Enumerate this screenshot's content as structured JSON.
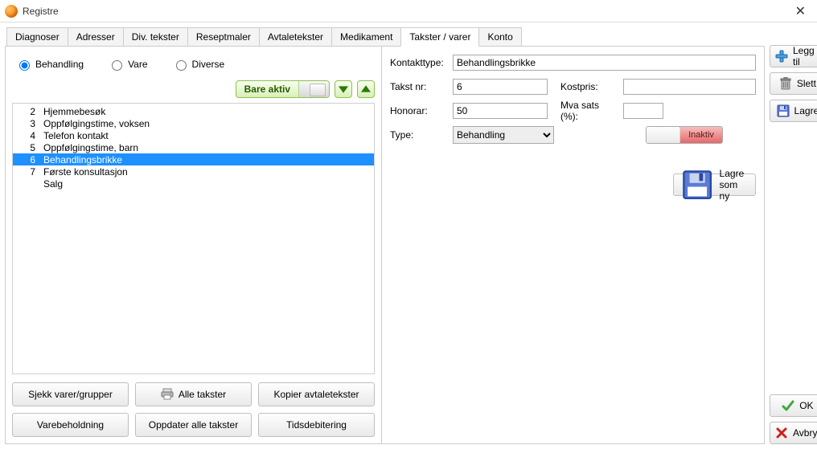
{
  "window": {
    "title": "Registre"
  },
  "tabs": [
    "Diagnoser",
    "Adresser",
    "Div. tekster",
    "Reseptmaler",
    "Avtaletekster",
    "Medikament",
    "Takster / varer",
    "Konto"
  ],
  "activeTab": "Takster / varer",
  "radios": {
    "behandling": "Behandling",
    "vare": "Vare",
    "diverse": "Diverse"
  },
  "filter": {
    "bare_aktiv": "Bare aktiv"
  },
  "list": [
    {
      "num": "2",
      "name": "Hjemmebesøk"
    },
    {
      "num": "3",
      "name": "Oppfølgingstime, voksen"
    },
    {
      "num": "4",
      "name": "Telefon kontakt"
    },
    {
      "num": "5",
      "name": "Oppfølgingstime, barn"
    },
    {
      "num": "6",
      "name": "Behandlingsbrikke"
    },
    {
      "num": "7",
      "name": "Første konsultasjon"
    },
    {
      "num": "",
      "name": "Salg"
    }
  ],
  "selectedIndex": 4,
  "bottomButtons": {
    "sjekk": "Sjekk varer/grupper",
    "alle": "Alle takster",
    "kopier": "Kopier avtaletekster",
    "varebeholdning": "Varebeholdning",
    "oppdater": "Oppdater alle takster",
    "tidsdebitering": "Tidsdebitering"
  },
  "form": {
    "kontakttype_label": "Kontakttype:",
    "kontakttype_value": "Behandlingsbrikke",
    "takstnr_label": "Takst nr:",
    "takstnr_value": "6",
    "kostpris_label": "Kostpris:",
    "kostpris_value": "",
    "honorar_label": "Honorar:",
    "honorar_value": "50",
    "mvasats_label": "Mva sats (%):",
    "mvasats_value": "",
    "type_label": "Type:",
    "type_value": "Behandling",
    "inaktiv_label": "Inaktiv",
    "lagre_som_ny": "Lagre som ny"
  },
  "side": {
    "leggtil": "Legg til",
    "slett": "Slett",
    "lagre": "Lagre",
    "ok": "OK",
    "avbryt": "Avbryt"
  }
}
